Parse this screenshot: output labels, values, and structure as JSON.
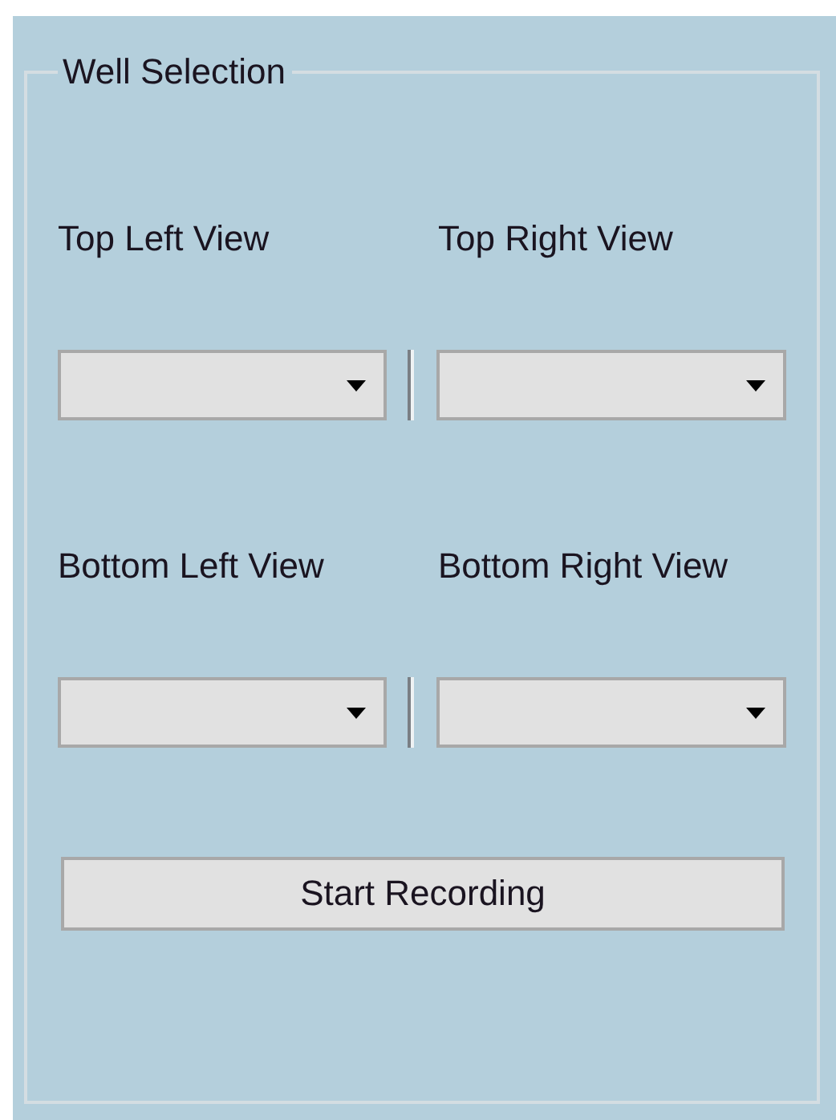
{
  "group": {
    "title": "Well Selection"
  },
  "view_rows": [
    {
      "views": [
        {
          "label": "Top Left View"
        },
        {
          "label": "Top Right View"
        }
      ]
    },
    {
      "views": [
        {
          "label": "Bottom Left View"
        },
        {
          "label": "Bottom Right View"
        }
      ]
    }
  ],
  "button": {
    "label": "Start Recording"
  }
}
